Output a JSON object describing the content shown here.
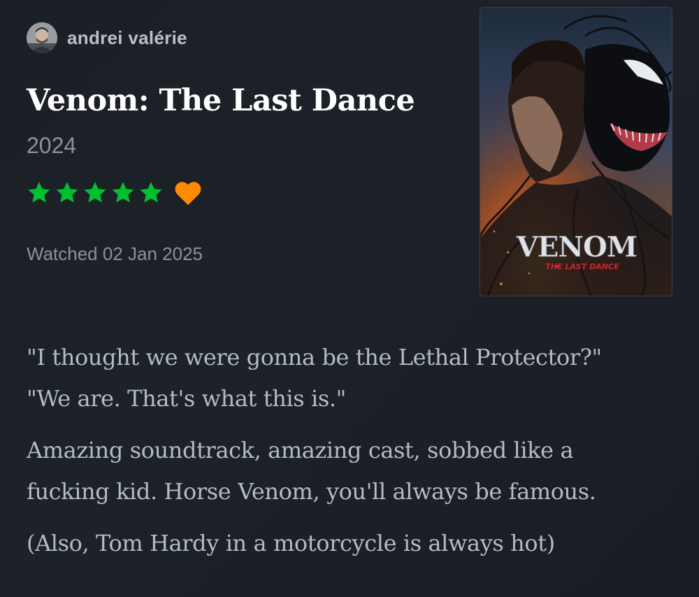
{
  "review": {
    "author": {
      "name": "andrei valérie",
      "avatar_icon": "user-avatar"
    },
    "film": {
      "title": "Venom: The Last Dance",
      "year": "2024",
      "poster": {
        "title_text": "VENOM",
        "subtitle_text": "THE LAST DANCE"
      }
    },
    "rating": {
      "stars": 5,
      "max_stars": 5,
      "star_color": "#00c030",
      "liked": true,
      "like_color": "#ff8a00"
    },
    "watched_label": "Watched 02 Jan 2025",
    "body": {
      "quote_line_1": "\"I thought we were gonna be the Lethal Protector?\"",
      "quote_line_2": "\"We are. That's what this is.\"",
      "paragraph_2_line_1": "Amazing soundtrack, amazing cast, sobbed like a",
      "paragraph_2_line_2": "fucking kid. Horse Venom, you'll always be famous.",
      "paragraph_3": "(Also, Tom Hardy in a motorcycle is always hot)"
    }
  }
}
